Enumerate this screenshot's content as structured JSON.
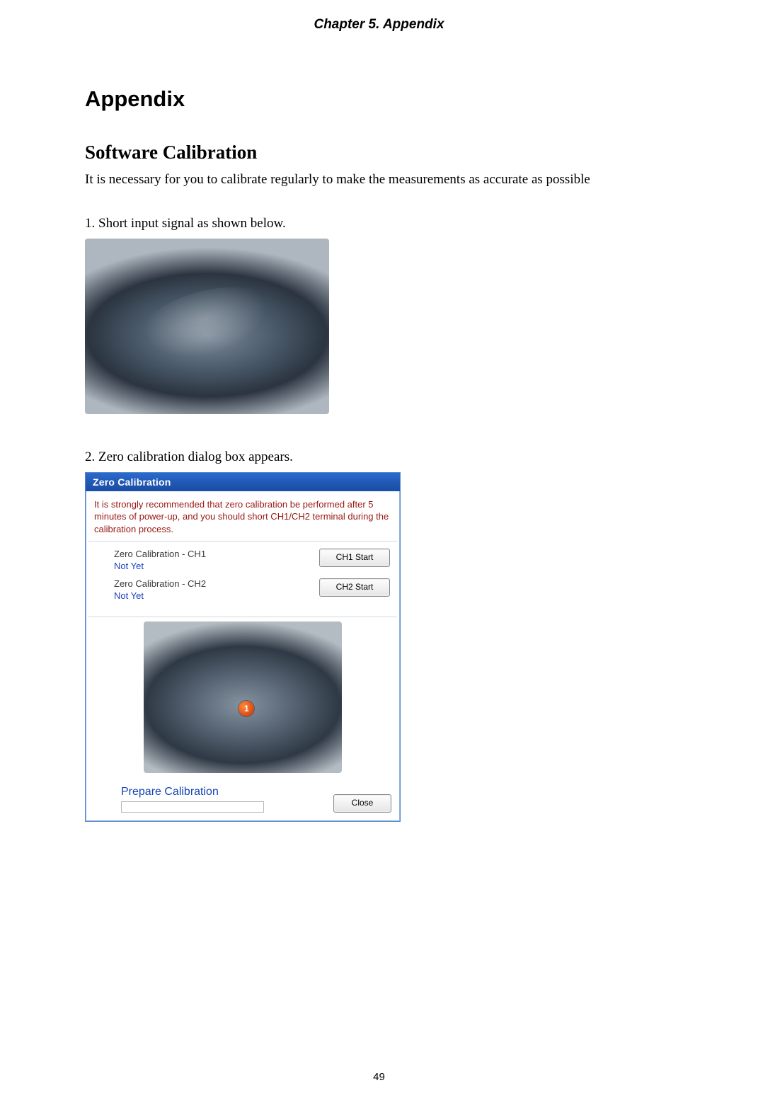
{
  "header": {
    "chapter": "Chapter 5. Appendix"
  },
  "title": "Appendix",
  "section_title": "Software Calibration",
  "intro": "It is necessary for you to calibrate regularly to make the measurements as accurate as possible",
  "steps": {
    "s1": "1. Short input signal as shown below.",
    "s2": "2. Zero calibration dialog box appears."
  },
  "dialog": {
    "title": "Zero Calibration",
    "instructions": "It is strongly recommended that zero calibration be performed after 5 minutes of power-up, and you should short CH1/CH2 terminal during the calibration process.",
    "rows": [
      {
        "label": "Zero Calibration - CH1",
        "status": "Not Yet",
        "button": "CH1 Start"
      },
      {
        "label": "Zero Calibration - CH2",
        "status": "Not Yet",
        "button": "CH2 Start"
      }
    ],
    "marker": "1",
    "prepare": "Prepare Calibration",
    "close": "Close"
  },
  "page_number": "49"
}
